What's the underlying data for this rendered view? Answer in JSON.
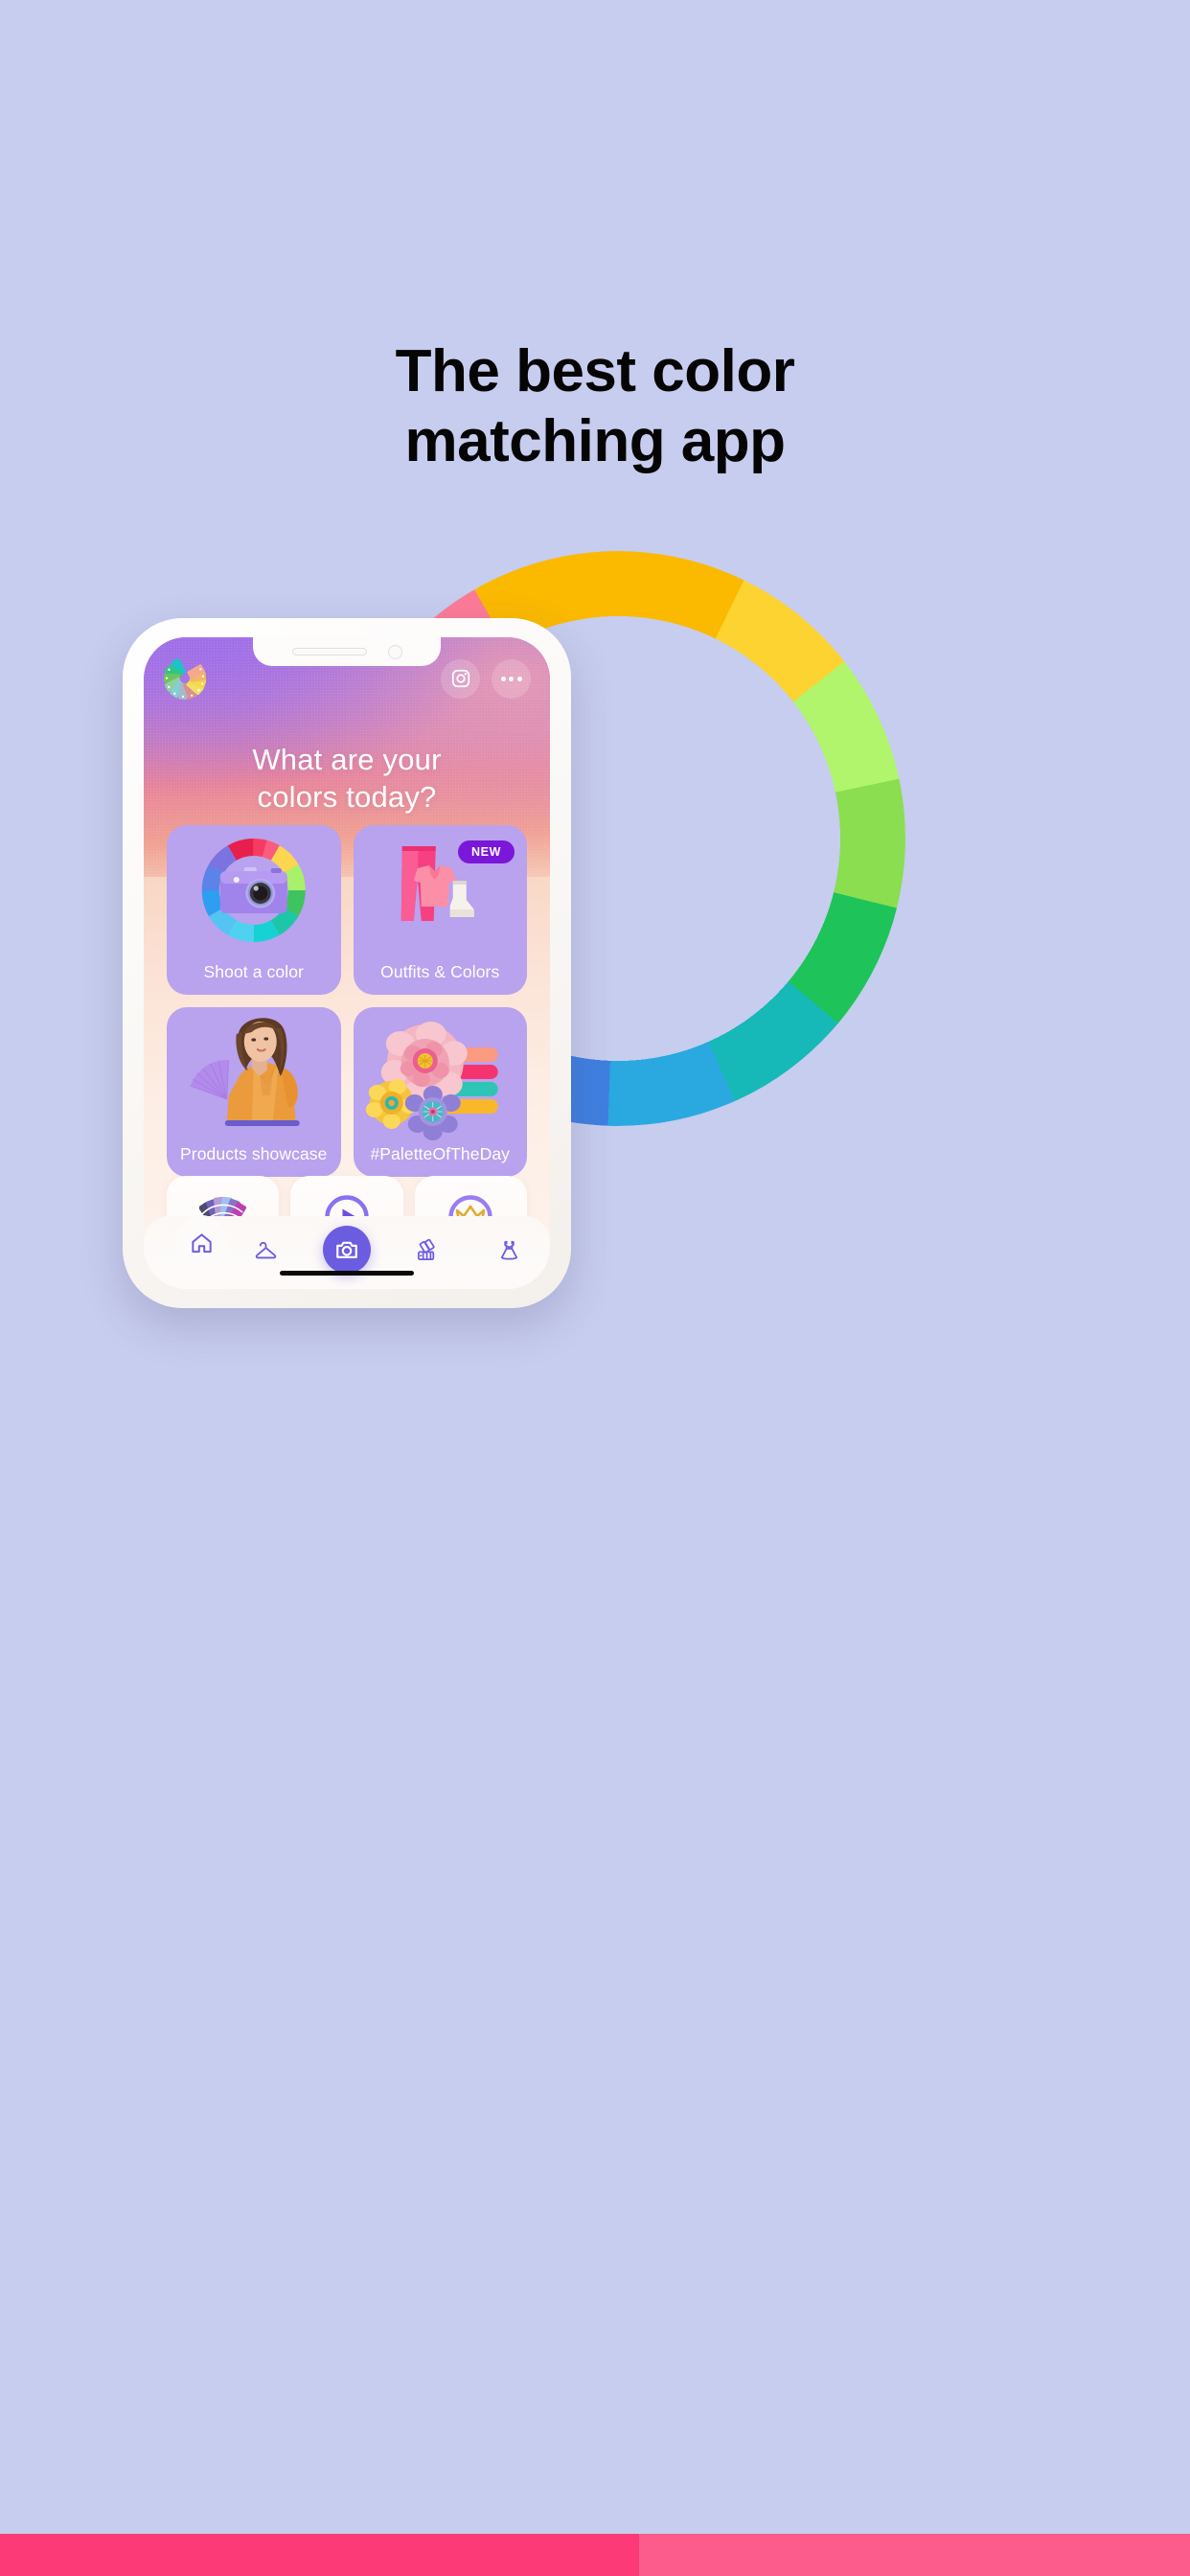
{
  "promo": {
    "title_line1": "The best color",
    "title_line2": "matching app",
    "title_color": "#050505",
    "background_color": "#c6cdee"
  },
  "app": {
    "logo_name": "color-fan-logo",
    "topbar": {
      "instagram_label": "Instagram",
      "more_label": "More options"
    },
    "hero": {
      "question_line1": "What are your",
      "question_line2": "colors today?"
    },
    "tiles": [
      {
        "label": "Shoot a color",
        "icon": "color-wheel-camera",
        "badge": null
      },
      {
        "label": "Outfits & Colors",
        "icon": "pink-outfit",
        "badge": "NEW"
      },
      {
        "label": "Products showcase",
        "icon": "woman-orange-dress",
        "badge": null
      },
      {
        "label": "#PaletteOfTheDay",
        "icon": "paper-flowers-palette",
        "badge": null
      }
    ],
    "mini_cards": [
      {
        "label": "Palettes",
        "icon": "swatch-fan-icon"
      },
      {
        "label": "Videos",
        "icon": "play-circle-icon"
      },
      {
        "label": "Go Premium",
        "icon": "crown-circle-icon"
      }
    ],
    "nav": [
      {
        "label": "Home",
        "icon": "home-icon",
        "active": true
      },
      {
        "label": "Wardrobe",
        "icon": "hanger-icon",
        "active": false
      },
      {
        "label": "Camera",
        "icon": "camera-icon",
        "active": false
      },
      {
        "label": "Palettes",
        "icon": "palette-swatches-icon",
        "active": false
      },
      {
        "label": "Outfits",
        "icon": "dress-icon",
        "active": false
      }
    ],
    "colors": {
      "accent_purple": "#6c5ce0",
      "tile_purple": "#b9a2ee",
      "badge_purple": "#7b17d8",
      "label_text": "#4a3b8d",
      "crown_gold": "#e8b93a"
    }
  },
  "decor": {
    "arc_name": "color-wheel-arc",
    "bottom_bar_color_left": "#fb3a77",
    "bottom_bar_color_right": "#fb5c8c"
  }
}
